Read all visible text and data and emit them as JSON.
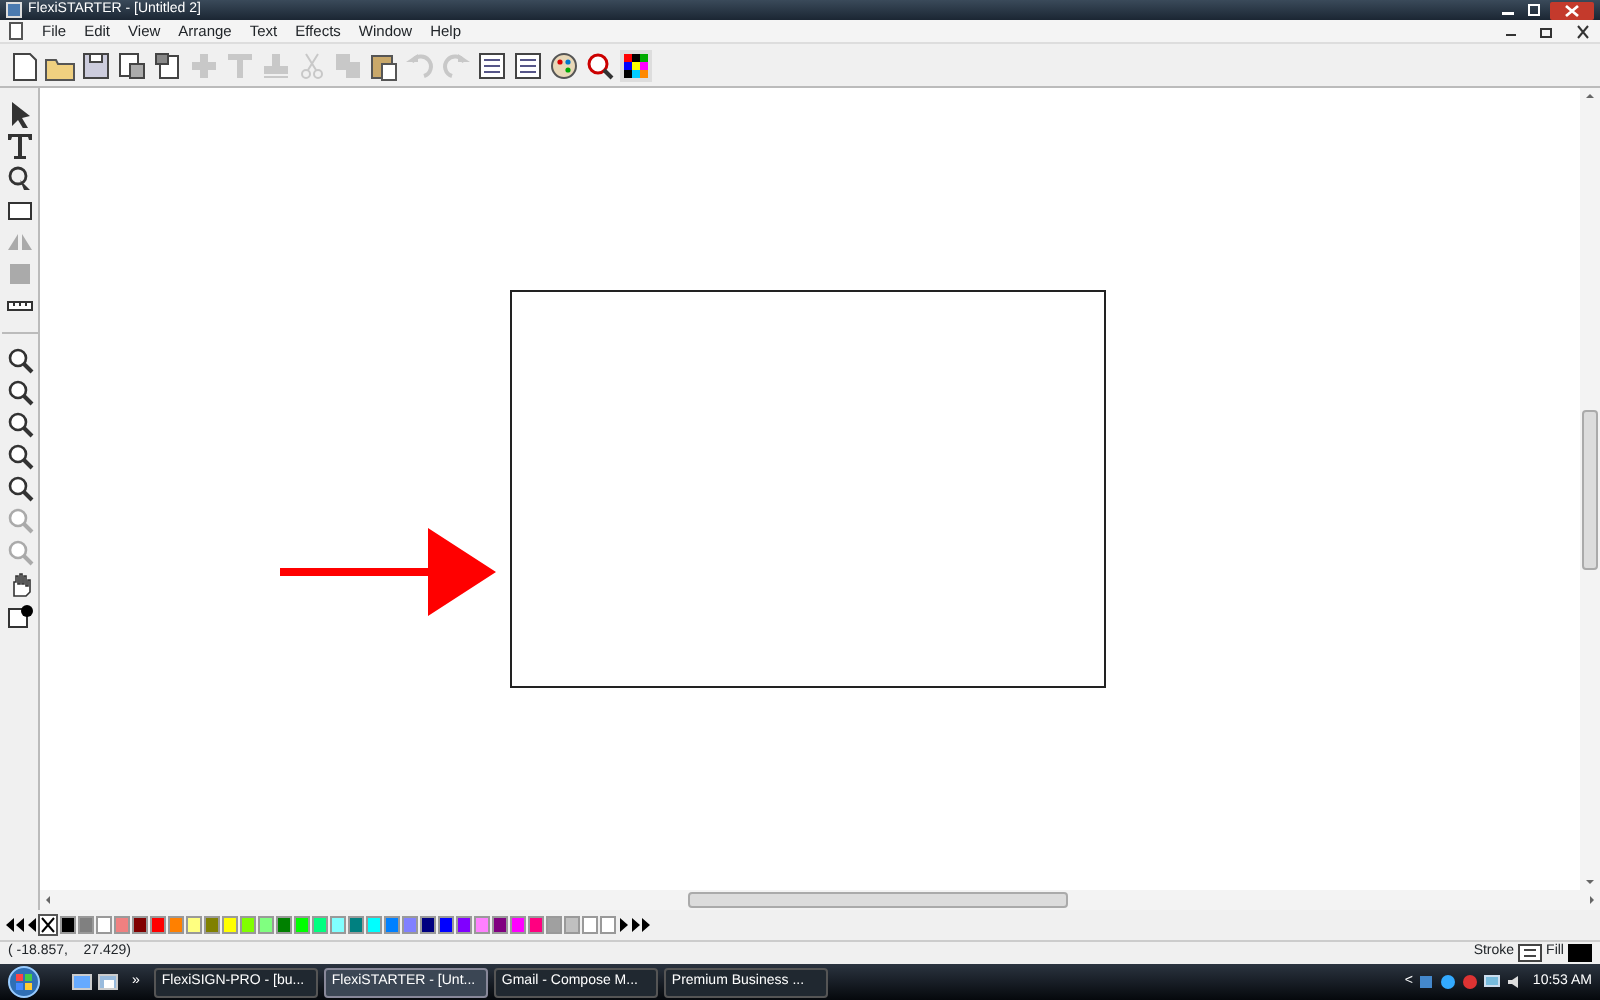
{
  "window": {
    "title": "FlexiSTARTER - [Untitled 2]"
  },
  "menu": [
    "File",
    "Edit",
    "View",
    "Arrange",
    "Text",
    "Effects",
    "Window",
    "Help"
  ],
  "toolbar": [
    {
      "kind": "page",
      "disabled": false
    },
    {
      "kind": "folder",
      "disabled": false
    },
    {
      "kind": "disk",
      "disabled": false
    },
    {
      "kind": "import",
      "disabled": false
    },
    {
      "kind": "export",
      "disabled": false
    },
    {
      "kind": "plus",
      "disabled": true
    },
    {
      "kind": "tee",
      "disabled": true
    },
    {
      "kind": "stamp",
      "disabled": true
    },
    {
      "kind": "scissors",
      "disabled": true
    },
    {
      "kind": "copy",
      "disabled": true
    },
    {
      "kind": "clipboard",
      "disabled": false
    },
    {
      "kind": "undo",
      "disabled": true
    },
    {
      "kind": "redo",
      "disabled": true
    },
    {
      "kind": "sheet",
      "disabled": false
    },
    {
      "kind": "sheet",
      "disabled": false
    },
    {
      "kind": "palette",
      "disabled": false
    },
    {
      "kind": "magnifier",
      "disabled": false
    },
    {
      "kind": "grid",
      "disabled": false
    }
  ],
  "tools": [
    {
      "kind": "pointer",
      "disabled": false
    },
    {
      "kind": "text",
      "disabled": false
    },
    {
      "kind": "shape",
      "disabled": false
    },
    {
      "kind": "rect",
      "disabled": false
    },
    {
      "kind": "mirror",
      "disabled": true
    },
    {
      "kind": "square",
      "disabled": true
    },
    {
      "kind": "ruler",
      "disabled": false
    },
    {
      "kind": "sep"
    },
    {
      "kind": "zoom",
      "disabled": false
    },
    {
      "kind": "zoom",
      "disabled": false
    },
    {
      "kind": "zoom",
      "disabled": false
    },
    {
      "kind": "zoom",
      "disabled": false
    },
    {
      "kind": "zoom",
      "disabled": false
    },
    {
      "kind": "zoom",
      "disabled": true
    },
    {
      "kind": "zoom",
      "disabled": true
    },
    {
      "kind": "hand",
      "disabled": false
    },
    {
      "kind": "fill",
      "disabled": false
    }
  ],
  "palette": [
    {
      "color": "#000000"
    },
    {
      "color": "#808080"
    },
    {
      "color": "#ffffff"
    },
    {
      "color": "#f08080"
    },
    {
      "color": "#800000"
    },
    {
      "color": "#ff0000"
    },
    {
      "color": "#ff8000"
    },
    {
      "color": "#ffff80"
    },
    {
      "color": "#808000"
    },
    {
      "color": "#ffff00"
    },
    {
      "color": "#80ff00"
    },
    {
      "color": "#80ff80"
    },
    {
      "color": "#008000"
    },
    {
      "color": "#00ff00"
    },
    {
      "color": "#00ff80"
    },
    {
      "color": "#80ffff"
    },
    {
      "color": "#008080"
    },
    {
      "color": "#00ffff"
    },
    {
      "color": "#0080ff"
    },
    {
      "color": "#8080ff"
    },
    {
      "color": "#000080"
    },
    {
      "color": "#0000ff"
    },
    {
      "color": "#8000ff"
    },
    {
      "color": "#ff80ff"
    },
    {
      "color": "#800080"
    },
    {
      "color": "#ff00ff"
    },
    {
      "color": "#ff0080"
    },
    {
      "color": "#a0a0a0"
    },
    {
      "color": "#c0c0c0"
    },
    {
      "color": "#ffffff"
    },
    {
      "color": "#ffffff"
    }
  ],
  "status_bar": {
    "coordinates": "( -18.857,    27.429)",
    "stroke_label": "Stroke",
    "fill_label": "Fill"
  },
  "taskbar": {
    "overflow": "»",
    "tasks": [
      {
        "label": "FlexiSIGN-PRO - [bu...",
        "selected": false
      },
      {
        "label": "FlexiSTARTER - [Unt...",
        "selected": true
      },
      {
        "label": "Gmail - Compose M...",
        "selected": false
      },
      {
        "label": "Premium Business ...",
        "selected": false
      }
    ],
    "tray_toggle": "<",
    "clock": "10:53 AM"
  }
}
